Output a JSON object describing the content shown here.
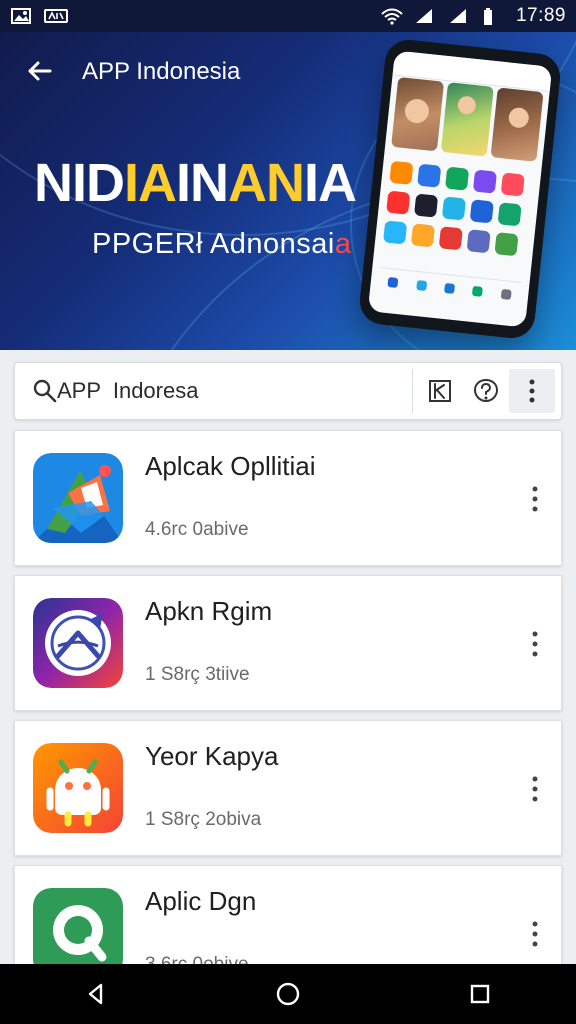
{
  "status_bar": {
    "time": "17:89",
    "left_icons": [
      "image-icon",
      "video-icon"
    ],
    "right_icons": [
      "wifi-icon",
      "signal-icon",
      "signal-icon-2",
      "battery-icon"
    ]
  },
  "header": {
    "title": "APP Indonesia"
  },
  "hero": {
    "title_part_1": "NID",
    "title_part_2": "IA",
    "title_part_3": "IN",
    "title_part_4": "AN",
    "title_part_5": "IA",
    "subtitle_main": "PPGERł Adnonsai",
    "subtitle_accent": "a"
  },
  "search": {
    "value": "APP  Indoresa",
    "placeholder": "APP  Indoresa",
    "tools": [
      "close-icon",
      "help-icon",
      "more-icon"
    ]
  },
  "apps": [
    {
      "name": "Aplcak Opllitiai",
      "meta": "4.6rc 0abive",
      "icon_name": "google-style-app-icon"
    },
    {
      "name": "Apkn Rgim",
      "meta": "1 S8rç 3tiive",
      "icon_name": "compass-app-icon"
    },
    {
      "name": "Yeor Kapya",
      "meta": "1 S8rç 2obiva",
      "icon_name": "android-app-icon"
    },
    {
      "name": "Aplic Dgn",
      "meta": "3 6rc 0obive",
      "icon_name": "search-app-icon"
    }
  ],
  "navigation": {
    "items": [
      "back-icon",
      "home-icon",
      "recent-apps-icon"
    ]
  },
  "colors": {
    "hero_dark": "#121b4d",
    "hero_light": "#1b8ed6",
    "hero_yellow": "#ffcc2d",
    "hero_red": "#ff4a4a",
    "background": "#eceff1",
    "card": "#ffffff",
    "text_primary": "#202020",
    "text_secondary": "#6a6a6a"
  }
}
